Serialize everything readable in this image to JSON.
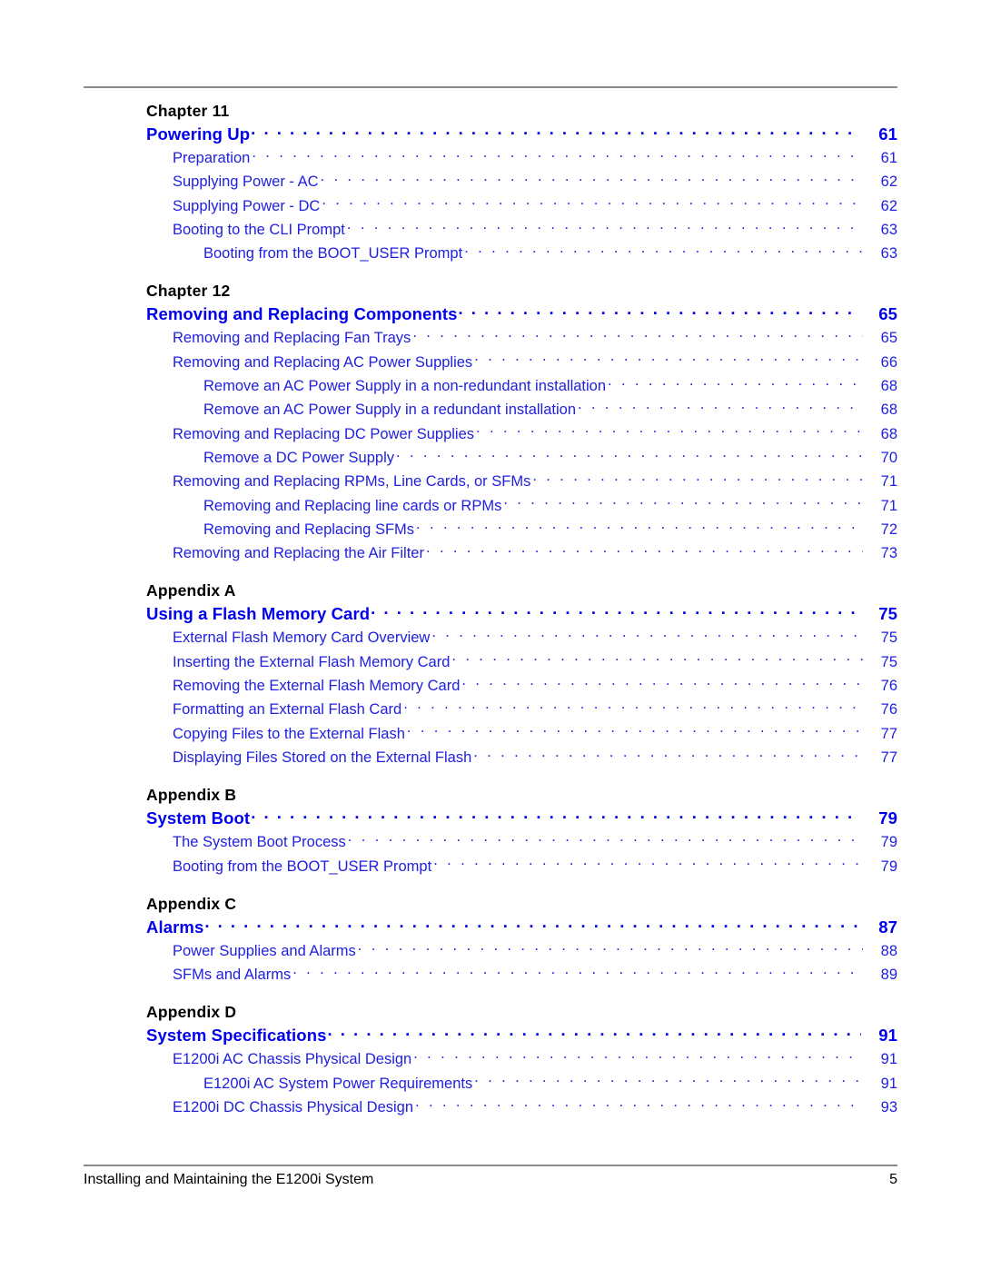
{
  "colors": {
    "heading_blue": "#0000EE",
    "entry_blue": "#2020E0",
    "rule_gray": "#8A8A8A",
    "label_black": "#000000"
  },
  "footer": {
    "title": "Installing and Maintaining the E1200i System",
    "page_number": "5"
  },
  "groups": [
    {
      "label": "Chapter 11",
      "heading": {
        "title": "Powering Up",
        "page": "61"
      },
      "entries": [
        {
          "level": 1,
          "title": "Preparation",
          "page": "61"
        },
        {
          "level": 1,
          "title": "Supplying Power - AC",
          "page": "62"
        },
        {
          "level": 1,
          "title": "Supplying Power - DC",
          "page": "62"
        },
        {
          "level": 1,
          "title": "Booting to the CLI Prompt",
          "page": "63"
        },
        {
          "level": 2,
          "title": "Booting from the BOOT_USER Prompt",
          "page": "63"
        }
      ]
    },
    {
      "label": "Chapter 12",
      "heading": {
        "title": "Removing and Replacing Components",
        "page": "65"
      },
      "entries": [
        {
          "level": 1,
          "title": "Removing and Replacing Fan Trays",
          "page": "65"
        },
        {
          "level": 1,
          "title": "Removing and Replacing AC Power Supplies",
          "page": "66"
        },
        {
          "level": 2,
          "title": "Remove an AC Power Supply in a non-redundant installation",
          "page": "68"
        },
        {
          "level": 2,
          "title": "Remove an AC Power Supply in a redundant installation",
          "page": "68"
        },
        {
          "level": 1,
          "title": "Removing and Replacing DC Power Supplies",
          "page": "68"
        },
        {
          "level": 2,
          "title": "Remove a DC Power Supply",
          "page": "70"
        },
        {
          "level": 1,
          "title": "Removing and Replacing RPMs, Line Cards, or SFMs",
          "page": "71"
        },
        {
          "level": 2,
          "title": "Removing and Replacing line cards or RPMs",
          "page": "71"
        },
        {
          "level": 2,
          "title": "Removing and Replacing SFMs",
          "page": "72"
        },
        {
          "level": 1,
          "title": "Removing and Replacing the Air Filter",
          "page": "73"
        }
      ]
    },
    {
      "label": "Appendix A",
      "heading": {
        "title": "Using a Flash Memory Card",
        "page": "75"
      },
      "entries": [
        {
          "level": 1,
          "title": "External Flash Memory Card Overview",
          "page": "75"
        },
        {
          "level": 1,
          "title": "Inserting the External Flash Memory Card",
          "page": "75"
        },
        {
          "level": 1,
          "title": "Removing the External Flash Memory Card",
          "page": "76"
        },
        {
          "level": 1,
          "title": "Formatting an External Flash Card",
          "page": "76"
        },
        {
          "level": 1,
          "title": "Copying Files to the External Flash",
          "page": "77"
        },
        {
          "level": 1,
          "title": "Displaying Files Stored on the External Flash",
          "page": "77"
        }
      ]
    },
    {
      "label": "Appendix B",
      "heading": {
        "title": "System Boot",
        "page": "79"
      },
      "entries": [
        {
          "level": 1,
          "title": "The System Boot Process",
          "page": "79"
        },
        {
          "level": 1,
          "title": "Booting from the BOOT_USER Prompt",
          "page": "79"
        }
      ]
    },
    {
      "label": "Appendix C",
      "heading": {
        "title": "Alarms",
        "page": "87"
      },
      "entries": [
        {
          "level": 1,
          "title": "Power Supplies and Alarms",
          "page": "88"
        },
        {
          "level": 1,
          "title": "SFMs and Alarms",
          "page": "89"
        }
      ]
    },
    {
      "label": "Appendix D",
      "heading": {
        "title": "System Specifications",
        "page": "91"
      },
      "entries": [
        {
          "level": 1,
          "title": "E1200i AC Chassis Physical Design",
          "page": "91"
        },
        {
          "level": 2,
          "title": "E1200i AC System Power Requirements",
          "page": "91"
        },
        {
          "level": 1,
          "title": "E1200i DC Chassis Physical Design",
          "page": "93"
        }
      ]
    }
  ]
}
